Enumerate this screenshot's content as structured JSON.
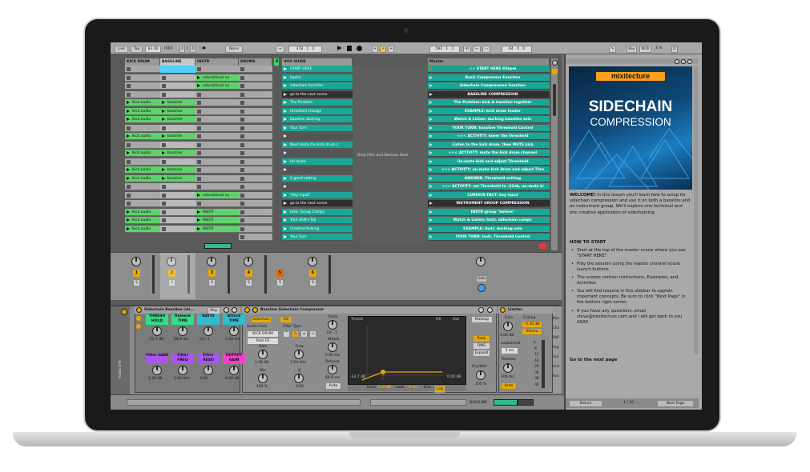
{
  "transport": {
    "link": "Link",
    "tap": "Tap",
    "tempo": "83.00",
    "meter_num": "4",
    "meter_den": "4",
    "quantize": "None",
    "position": "378 . 1 . 2",
    "loop_start": "593 . 1 . 1",
    "loop_len": "64 . 0 . 0",
    "key": "Key",
    "midi": "MIDI",
    "cpu": "1 %",
    "hd": "D"
  },
  "tracks": [
    "KICK DRUM",
    "BASSLINE",
    "INSTR",
    "DRUMS",
    "R",
    "VOX GUIDE",
    "Master"
  ],
  "clips": {
    "kick": [
      "",
      "",
      "",
      "",
      "Kick audio",
      "Kick audio",
      "Kick audio",
      "",
      "Kick audio",
      "",
      "Kick audio",
      "",
      "Kick audio",
      "Kick audio",
      "",
      "",
      "",
      "Kick audio",
      "Kick audio",
      "Kick audio"
    ],
    "bass": [
      "",
      "",
      "",
      "",
      "bassline",
      "bassline",
      "bassline",
      "",
      "bassline",
      "",
      "bassline",
      "",
      "bassline",
      "bassline",
      "",
      "",
      "",
      "",
      "",
      ""
    ],
    "instr": [
      "",
      "educational ex",
      "educational ex",
      "",
      "",
      "",
      "",
      "",
      "",
      "",
      "",
      "",
      "",
      "",
      "",
      "educational ex",
      "",
      "INSTR",
      "INSTR",
      "INSTR"
    ]
  },
  "vox": [
    "START HERE",
    "basics",
    "sidechain function",
    "go to the next scene",
    "The Problem",
    "threshold change",
    "bassline ducking",
    "Your Turn",
    "",
    "Next mute the kick drum c",
    "",
    "Un-mute",
    "",
    "A good setting",
    "",
    "\"Key Input\"",
    "go to the next scene",
    "Instr. Group Compr.",
    "Trk3 Shift+Tab",
    "Creative Pulsing",
    "Your Turn"
  ],
  "drop_text": "Drop Files and Devices Here",
  "master_scenes": [
    "<< START HERE  83bpm",
    "Basic Compressor Function",
    "Sidechain Compression Function",
    "BASSLINE COMPRESSION",
    "The Problem: kick & bassline together",
    "EXAMPLE: kick drum louder",
    "Watch & Listen: ducking bassline solo",
    "YOUR TURN: bassline Threshold Control",
    "<<< ACTIVITY: lower the threshold",
    "Listen to the kick drum, then MUTE kick",
    "<<< ACTIVITY: mute the kick drum channel",
    "Un-mute kick and adjust Threshold",
    "<<< ACTIVITY: un-mute kick drum and adjust Thre",
    "ANSWER: Threshold setting",
    "<<< ACTIVITY: set Threshold to -32db, un-mute ki",
    "CURIOUS FACT: key input",
    "INSTRUMENT GROUP COMPRESSION",
    "INSTR group \"before\"",
    "Watch & Listen: Instr. sidechain compr.",
    "EXAMPLE: Instr. ducking solo",
    "YOUR TURN: Instr. Threshold Control"
  ],
  "mixer": {
    "track_nums": [
      "1",
      "2",
      "3",
      "4",
      "5",
      "6"
    ],
    "s": "S",
    "solo": "Solo"
  },
  "devices": {
    "rack_title": "Sidechain Bassline (mi...",
    "map": "Map",
    "macros": [
      {
        "name": "THRESH HOLD",
        "val": "-32.7 dB",
        "color": "#33dd88"
      },
      {
        "name": "Release TIME",
        "val": "68.8 ms",
        "color": "#33dd88"
      },
      {
        "name": "RATIO",
        "val": "inf : 1",
        "color": "#33bbcc"
      },
      {
        "name": "Attack TIME",
        "val": "5.00 ms",
        "color": "#33bbcc"
      },
      {
        "name": "Filter GAIN",
        "val": "1.36 dB",
        "color": "#aa55ee"
      },
      {
        "name": "Filter FREQ",
        "val": "2.50 kHz",
        "color": "#aa55ee"
      },
      {
        "name": "Filter RESO",
        "val": "3.00",
        "color": "#aa55ee"
      },
      {
        "name": "OUTPUT GAIN",
        "val": "0.00 dB",
        "color": "#ee44cc"
      }
    ],
    "audio_fx": "Audio Effe",
    "comp_title": "Bassline Sidechain Compressor",
    "sidechain": "Sidechain",
    "eq": "EQ",
    "audio_from": "Audio From",
    "audio_from_val": "KICK DRUM",
    "post_fx": "Post FX",
    "filter_type": "Filter Type",
    "gain_lbl": "Gain",
    "gain_val": "1.36 dB",
    "mix_lbl": "Mix",
    "mix_val": "100 %",
    "freq_lbl": "Freq",
    "freq_val": "2.50 kHz",
    "q_lbl": "Q",
    "q_val": "3.00",
    "ratio_lbl": "Ratio",
    "ratio_val": "inf : 1",
    "attack_lbl": "Attack",
    "attack_val": "5.00 ms",
    "release_lbl": "Release",
    "release_val": "68.8 ms",
    "auto": "Auto",
    "thresh_lbl": "Thresh",
    "gr": "GR",
    "out": "Out",
    "thresh_val": "-32.7 dB",
    "out_val": "0.00 dB",
    "knee": "Knee",
    "knee_val": "3.0 dB",
    "look": "Look.",
    "look_val": "0 ms",
    "env": "Env.",
    "env_val": "Log",
    "makeup": "Makeup",
    "peak": "Peak",
    "rms": "RMS",
    "expand": "Expand",
    "drywet": "Dry/Wet",
    "drywet_val": "100 %",
    "limiter": "Limiter",
    "lim_gain": "Gain",
    "lim_gain_val": "0.00 dB",
    "ceiling": "Ceiling",
    "ceiling_val": "-0.30 dB",
    "stereo": "Stereo",
    "lookahead": "Lookahead",
    "lookahead_val": "3 ms",
    "lim_release": "Release",
    "lim_release_val": "300 ms",
    "lim_auto": "Auto",
    "meter_scale": [
      "0",
      "-6",
      "-12",
      "-18",
      "-24",
      "-30",
      "-36",
      "-42"
    ],
    "extra": [
      "Bloc",
      "Cha",
      "Refi",
      "Avg",
      "Grp",
      "Scal",
      "Run"
    ]
  },
  "status": {
    "track": "BASSLINE"
  },
  "sidebar": {
    "brand": "mixitecture",
    "title1": "SIDECHAIN",
    "title2": "COMPRESSION",
    "welcome_label": "WELCOME!",
    "welcome": "In this lesson you'll learn how to setup for sidechain compression and use it on both a bassline and an instrument group.  We'll explore one technical and one creative application of sidechaining.",
    "how_to": "HOW TO START",
    "bullets": [
      "Start at the top of the master scene where you see \"START HERE\"",
      "Play the session using the master channel scene launch buttons",
      "The scenes contain Instructions, Examples, and Activities",
      "You will find lessons in this sidebar to explain important concepts. Be sure to click \"Next Page\" in the bottom right corner.",
      "If you have any questions, email steve@mixitecture.com and I will get back to you ASAP."
    ],
    "goto": "Go to the next page",
    "return": "Return",
    "page": "1 / 10",
    "next": "Next Page"
  },
  "colors": {
    "clip_green": "#5fd16a",
    "clip_teal": "#1aa896",
    "accent_yellow": "#e8a800",
    "selected_track": "#4fd1ff"
  }
}
